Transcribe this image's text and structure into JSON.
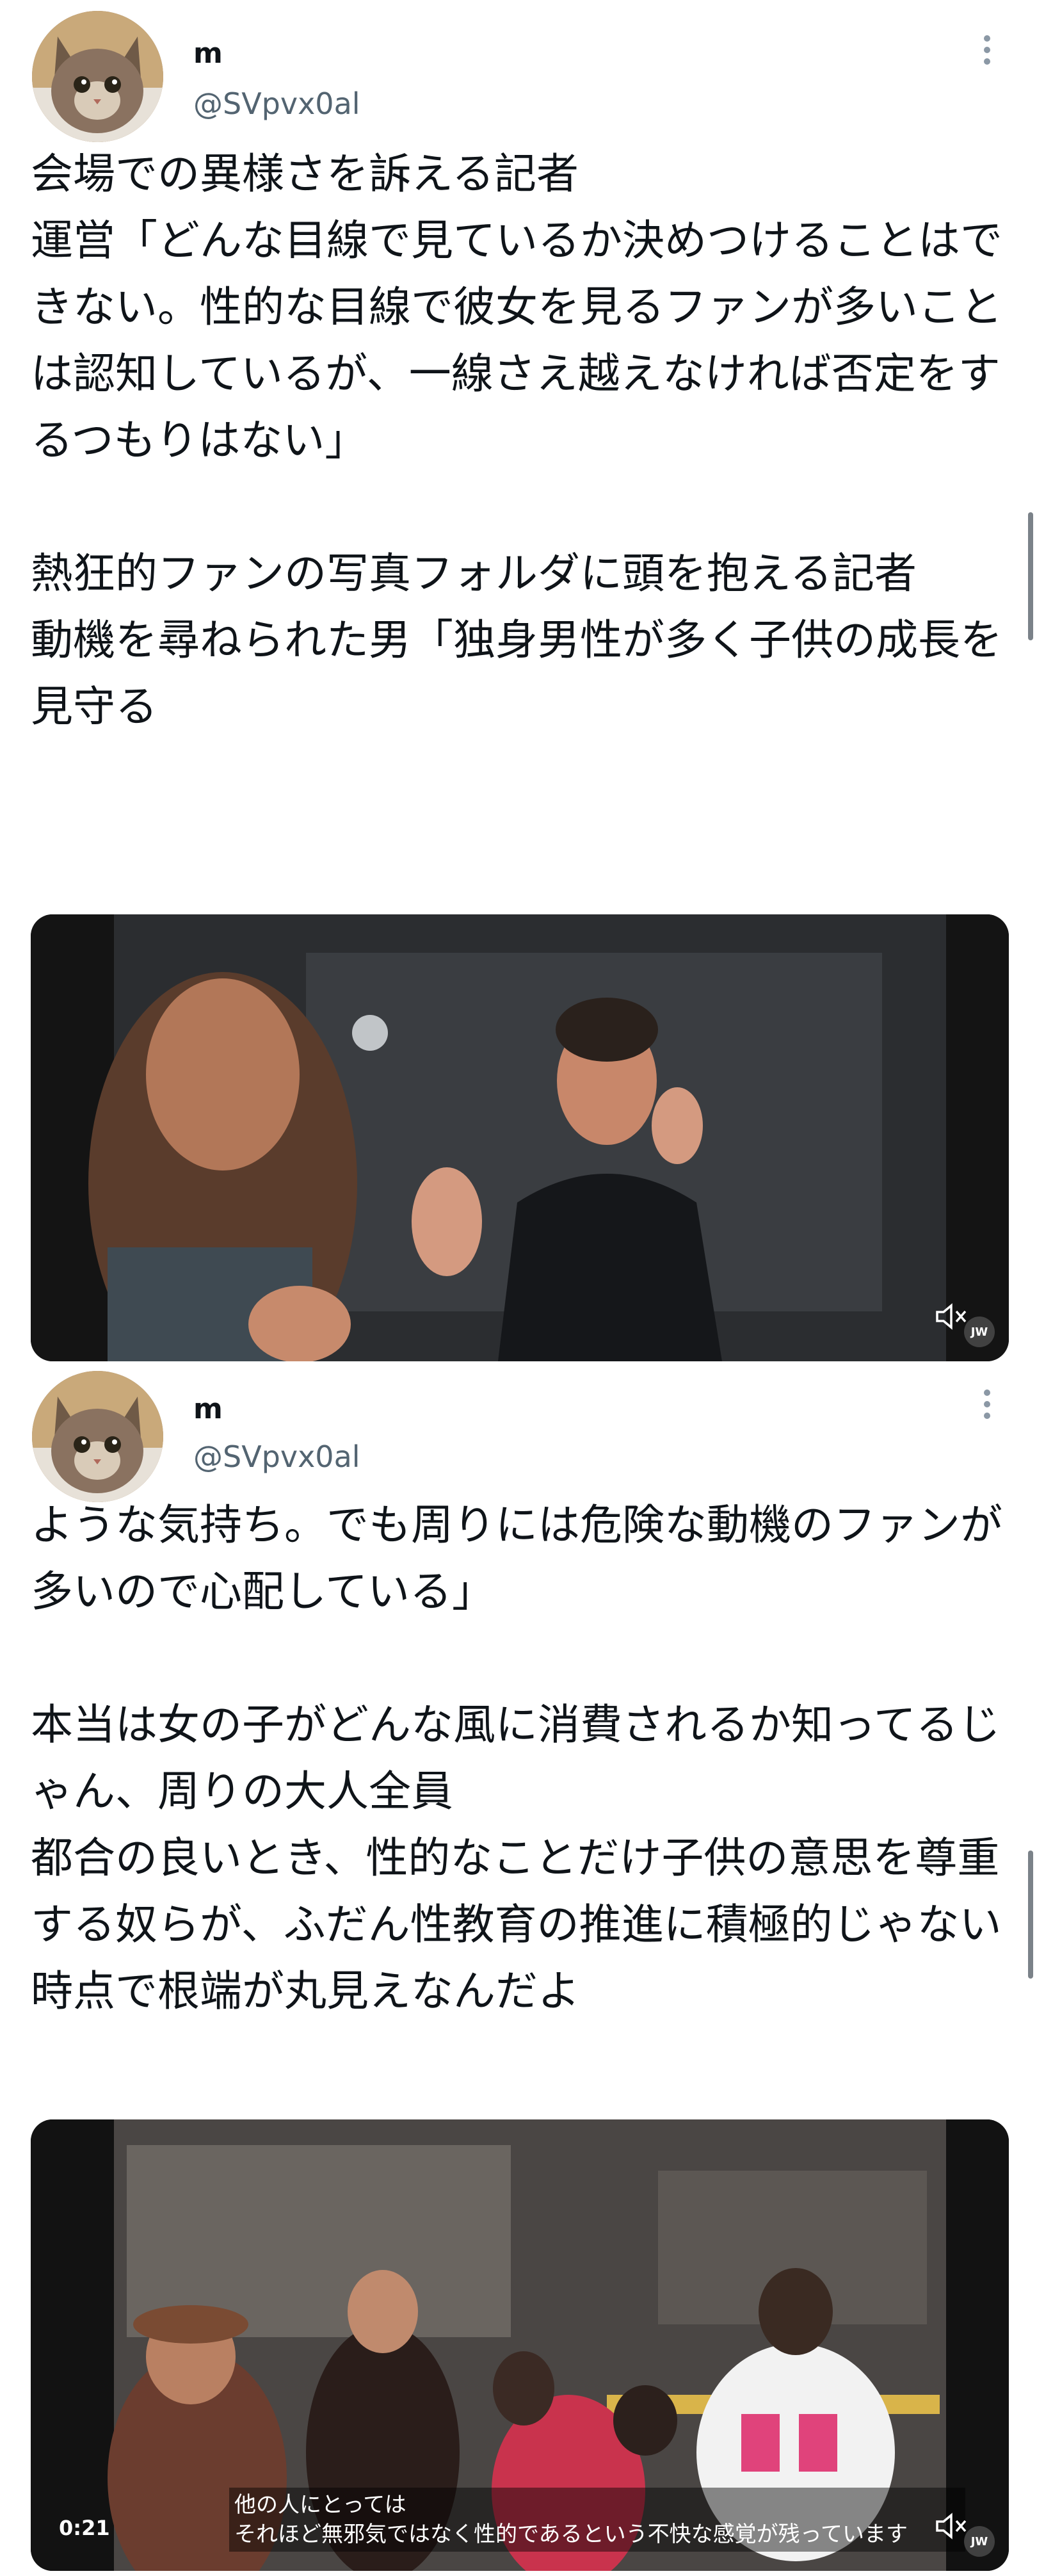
{
  "posts": [
    {
      "user": {
        "name": "m",
        "handle": "@SVpvx0al"
      },
      "text": "会場での異様さを訴える記者\n運営「どんな目線で見ているか決めつけることはできない。性的な目線で彼女を見るファンが多いことは認知しているが、一線さえ越えなければ否定をするつもりはない」\n\n熱狂的ファンの写真フォルダに頭を抱える記者\n動機を尋ねられた男「独身男性が多く子供の成長を見守る",
      "media": {
        "badge": "JW",
        "mute_icon": "speaker-muted-icon"
      }
    },
    {
      "user": {
        "name": "m",
        "handle": "@SVpvx0al"
      },
      "text": "ような気持ち。でも周りには危険な動機のファンが多いので心配している」\n\n本当は女の子がどんな風に消費されるか知ってるじゃん、周りの大人全員\n都合の良いとき、性的なことだけ子供の意思を尊重する奴らが、ふだん性教育の推進に積極的じゃない時点で根端が丸見えなんだよ",
      "media": {
        "duration": "0:21",
        "subtitle_line1": "他の人にとっては",
        "subtitle_line2": "それほど無邪気ではなく性的であるという不快な感覚が残っています",
        "badge": "JW",
        "mute_icon": "speaker-muted-icon"
      }
    }
  ],
  "colors": {
    "text": "#0f1419",
    "secondary": "#536471",
    "media_bg": "#0b0b0b"
  }
}
